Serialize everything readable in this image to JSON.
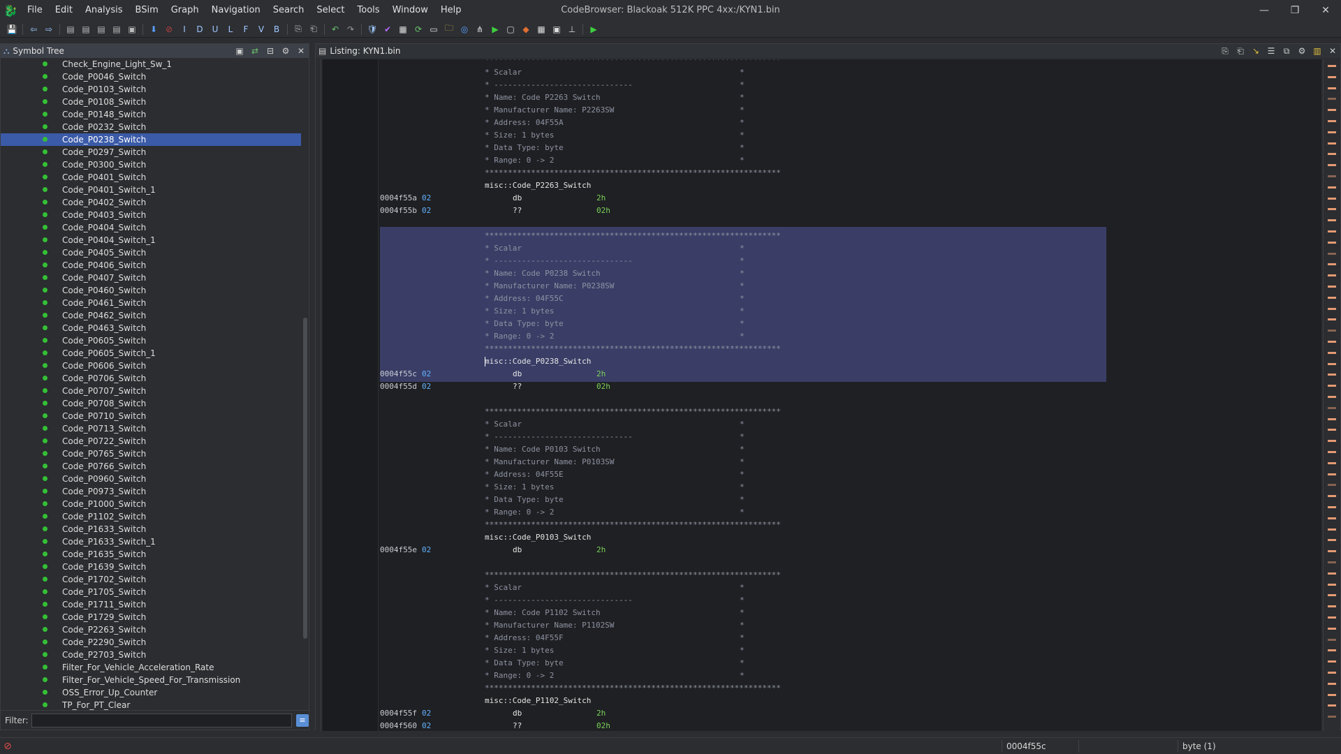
{
  "window": {
    "title": "CodeBrowser: Blackoak 512K PPC 4xx:/KYN1.bin",
    "controls": {
      "minimize": "—",
      "maximize": "❐",
      "close": "✕"
    }
  },
  "menu": [
    "File",
    "Edit",
    "Analysis",
    "BSim",
    "Graph",
    "Navigation",
    "Search",
    "Select",
    "Tools",
    "Window",
    "Help"
  ],
  "toolbar": {
    "labels": [
      "I",
      "D",
      "U",
      "L",
      "F",
      "V",
      "B"
    ]
  },
  "symbol_tree": {
    "title": "Symbol Tree",
    "selected_index": 6,
    "items": [
      "Check_Engine_Light_Sw_1",
      "Code_P0046_Switch",
      "Code_P0103_Switch",
      "Code_P0108_Switch",
      "Code_P0148_Switch",
      "Code_P0232_Switch",
      "Code_P0238_Switch",
      "Code_P0297_Switch",
      "Code_P0300_Switch",
      "Code_P0401_Switch",
      "Code_P0401_Switch_1",
      "Code_P0402_Switch",
      "Code_P0403_Switch",
      "Code_P0404_Switch",
      "Code_P0404_Switch_1",
      "Code_P0405_Switch",
      "Code_P0406_Switch",
      "Code_P0407_Switch",
      "Code_P0460_Switch",
      "Code_P0461_Switch",
      "Code_P0462_Switch",
      "Code_P0463_Switch",
      "Code_P0605_Switch",
      "Code_P0605_Switch_1",
      "Code_P0606_Switch",
      "Code_P0706_Switch",
      "Code_P0707_Switch",
      "Code_P0708_Switch",
      "Code_P0710_Switch",
      "Code_P0713_Switch",
      "Code_P0722_Switch",
      "Code_P0765_Switch",
      "Code_P0766_Switch",
      "Code_P0960_Switch",
      "Code_P0973_Switch",
      "Code_P1000_Switch",
      "Code_P1102_Switch",
      "Code_P1633_Switch",
      "Code_P1633_Switch_1",
      "Code_P1635_Switch",
      "Code_P1639_Switch",
      "Code_P1702_Switch",
      "Code_P1705_Switch",
      "Code_P1711_Switch",
      "Code_P1729_Switch",
      "Code_P2263_Switch",
      "Code_P2290_Switch",
      "Code_P2703_Switch",
      "Filter_For_Vehicle_Acceleration_Rate",
      "Filter_For_Vehicle_Speed_For_Transmission",
      "OSS_Error_Up_Counter",
      "TP_For_PT_Clear"
    ],
    "filter_label": "Filter:",
    "filter_value": ""
  },
  "listing": {
    "title": "Listing:  KYN1.bin",
    "stars": "****************************************************************",
    "blocks": [
      {
        "name": "Code P2263 Switch",
        "mfr": "P2263SW",
        "address": "04F55A",
        "label": "misc::Code_P2263_Switch",
        "rows": [
          {
            "addr": "0004f55a",
            "byte": "02",
            "mnem": "db",
            "op": "2h"
          },
          {
            "addr": "0004f55b",
            "byte": "02",
            "mnem": "??",
            "op": "02h"
          }
        ],
        "header_cut": true
      },
      {
        "name": "Code P0238 Switch",
        "mfr": "P0238SW",
        "address": "04F55C",
        "label": "misc::Code_P0238_Switch",
        "rows": [
          {
            "addr": "0004f55c",
            "byte": "02",
            "mnem": "db",
            "op": "2h"
          },
          {
            "addr": "0004f55d",
            "byte": "02",
            "mnem": "??",
            "op": "02h"
          }
        ],
        "selected": true
      },
      {
        "name": "Code P0103 Switch",
        "mfr": "P0103SW",
        "address": "04F55E",
        "label": "misc::Code_P0103_Switch",
        "rows": [
          {
            "addr": "0004f55e",
            "byte": "02",
            "mnem": "db",
            "op": "2h"
          }
        ]
      },
      {
        "name": "Code P1102 Switch",
        "mfr": "P1102SW",
        "address": "04F55F",
        "label": "misc::Code_P1102_Switch",
        "rows": [
          {
            "addr": "0004f55f",
            "byte": "02",
            "mnem": "db",
            "op": "2h"
          },
          {
            "addr": "0004f560",
            "byte": "02",
            "mnem": "??",
            "op": "02h"
          }
        ]
      }
    ],
    "comment": {
      "kind": "* Scalar",
      "rule": "* ------------------------------",
      "name_prefix": "* Name: ",
      "mfr_prefix": "* Manufacturer Name: ",
      "addr_prefix": "* Address: ",
      "size": "* Size: 1 bytes",
      "dtype": "* Data Type: byte",
      "range": "* Range: 0 -> 2",
      "end": "*"
    }
  },
  "statusbar": {
    "address": "0004f55c",
    "dtype": "byte (1)"
  }
}
